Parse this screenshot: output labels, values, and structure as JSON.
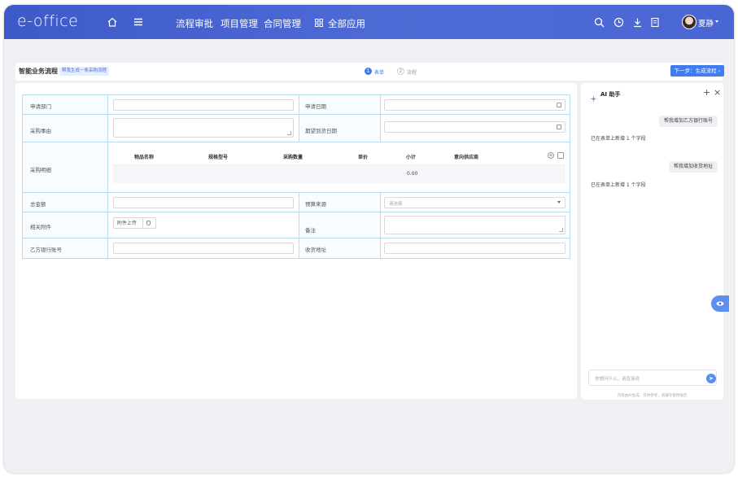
{
  "app": {
    "logo": "e-office"
  },
  "topbar": {
    "nav": [
      "流程审批",
      "项目管理",
      "合同管理"
    ],
    "all_apps": "全部应用",
    "user_name": "夏静",
    "icons": [
      "home-icon",
      "menu-icon",
      "apps-grid-icon",
      "search-icon",
      "clock-icon",
      "download-icon",
      "document-icon",
      "chevron-down-icon"
    ]
  },
  "crumb": {
    "title": "智能业务流程",
    "tag": "帮我生成一条采购流程",
    "steps": [
      {
        "num": "1",
        "label": "表单"
      },
      {
        "num": "2",
        "label": "流程"
      }
    ],
    "step_sep": "·",
    "next_button": "下一步：生成流程 ›"
  },
  "form": {
    "apply_dept_label": "申请部门",
    "apply_date_label": "申请日期",
    "purchase_reason_label": "采购事由",
    "expected_date_label": "期望到货日期",
    "purchase_detail_label": "采购明细",
    "detail_headers": [
      "物品名称",
      "规格型号",
      "采购数量",
      "单价",
      "小计",
      "意向供应商"
    ],
    "subtotal_value": "0.00",
    "total_label": "总金额",
    "budget_label": "预算来源",
    "budget_placeholder": "请选择",
    "attachment_label": "相关附件",
    "upload_label": "附件上传",
    "remark_label": "备注",
    "bank_label": "乙方银行账号",
    "address_label": "收货地址"
  },
  "ai": {
    "title": "AI 助手",
    "plus": "+",
    "close": "×",
    "messages": [
      {
        "user": "帮我增加乙方银行账号",
        "reply": "已在表单上新增 1 个字段"
      },
      {
        "user": "帮我增加收货地址",
        "reply": "已在表单上新增 1 个字段"
      }
    ],
    "input_placeholder": "你想问什么，请直接说",
    "send": "➤",
    "footer": "内容由AI生成，仅供参考，请遵守使用规范"
  },
  "colors": {
    "topbar": "#4a66d4",
    "accent": "#3f7cf0",
    "cell_border": "#b9def2"
  }
}
